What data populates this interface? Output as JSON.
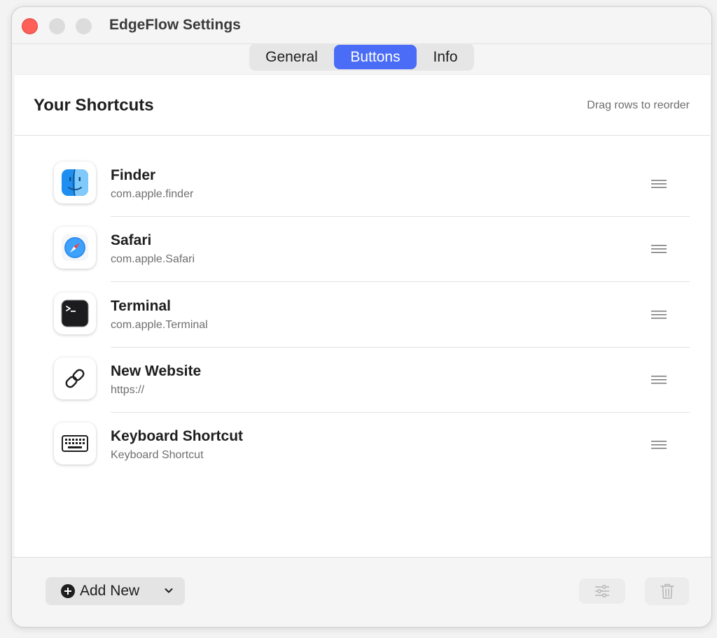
{
  "window": {
    "title": "EdgeFlow Settings"
  },
  "tabs": [
    {
      "label": "General",
      "selected": false
    },
    {
      "label": "Buttons",
      "selected": true
    },
    {
      "label": "Info",
      "selected": false
    }
  ],
  "panel": {
    "title": "Your Shortcuts",
    "hint": "Drag rows to reorder"
  },
  "shortcuts": [
    {
      "name": "Finder",
      "subtitle": "com.apple.finder",
      "icon": "finder-icon"
    },
    {
      "name": "Safari",
      "subtitle": "com.apple.Safari",
      "icon": "safari-icon"
    },
    {
      "name": "Terminal",
      "subtitle": "com.apple.Terminal",
      "icon": "terminal-icon"
    },
    {
      "name": "New Website",
      "subtitle": "https://",
      "icon": "link-icon"
    },
    {
      "name": "Keyboard Shortcut",
      "subtitle": "Keyboard Shortcut",
      "icon": "keyboard-icon"
    }
  ],
  "footer": {
    "add_label": "Add New"
  },
  "colors": {
    "accent": "#4a6cf7",
    "close": "#fe5f57"
  }
}
